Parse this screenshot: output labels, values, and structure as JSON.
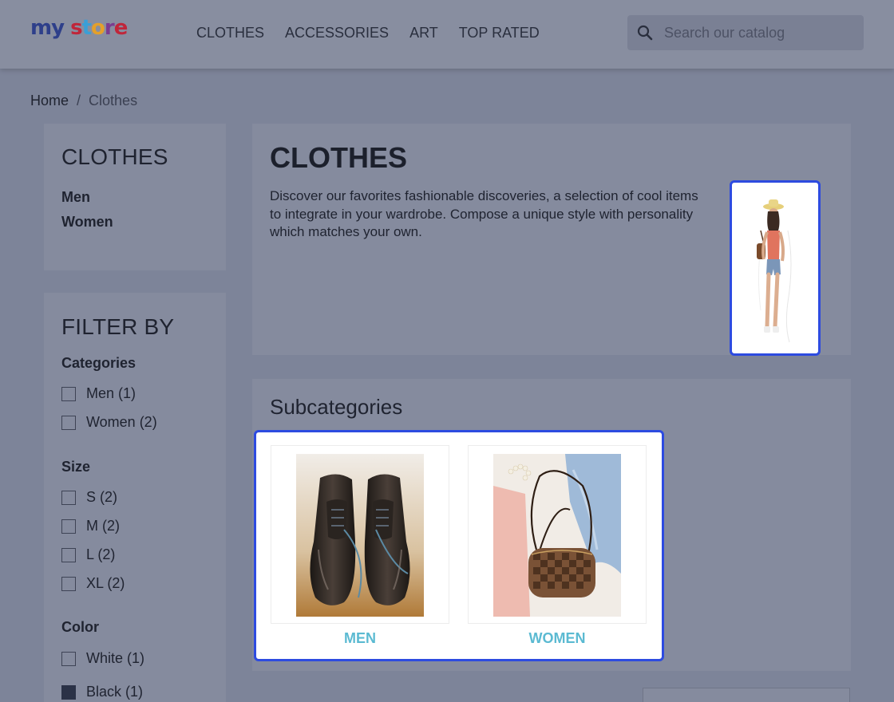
{
  "header": {
    "logo": {
      "m": "my",
      "s": "s",
      "t": "t",
      "o": "o",
      "r": "r",
      "e": "e"
    },
    "nav": [
      {
        "label": "CLOTHES"
      },
      {
        "label": "ACCESSORIES"
      },
      {
        "label": "ART"
      },
      {
        "label": "TOP RATED"
      }
    ],
    "search": {
      "placeholder": "Search our catalog",
      "value": "",
      "icon": "search-icon"
    }
  },
  "breadcrumb": {
    "home": "Home",
    "separator": "/",
    "current": "Clothes"
  },
  "sidebar": {
    "category_title": "CLOTHES",
    "subcategories": [
      "Men",
      "Women"
    ],
    "filter_title": "FILTER BY",
    "groups": [
      {
        "title": "Categories",
        "options": [
          {
            "label": "Men (1)",
            "checked": false
          },
          {
            "label": "Women (2)",
            "checked": false
          }
        ]
      },
      {
        "title": "Size",
        "options": [
          {
            "label": "S (2)",
            "checked": false
          },
          {
            "label": "M (2)",
            "checked": false
          },
          {
            "label": "L (2)",
            "checked": false
          },
          {
            "label": "XL (2)",
            "checked": false
          }
        ]
      },
      {
        "title": "Color",
        "options": [
          {
            "label": "White (1)",
            "swatch": "#ffffff"
          },
          {
            "label": "Black (1)",
            "swatch": "#2b3247"
          }
        ]
      }
    ]
  },
  "main": {
    "title": "CLOTHES",
    "description": "Discover our favorites fashionable discoveries, a selection of cool items to integrate in your wardrobe. Compose a unique style with personality which matches your own.",
    "subcategories_title": "Subcategories",
    "subcategories": [
      {
        "label": "MEN"
      },
      {
        "label": "WOMEN"
      }
    ]
  },
  "colors": {
    "accent_highlight": "#2d4be0",
    "subcategory_link": "#5bbad2"
  }
}
